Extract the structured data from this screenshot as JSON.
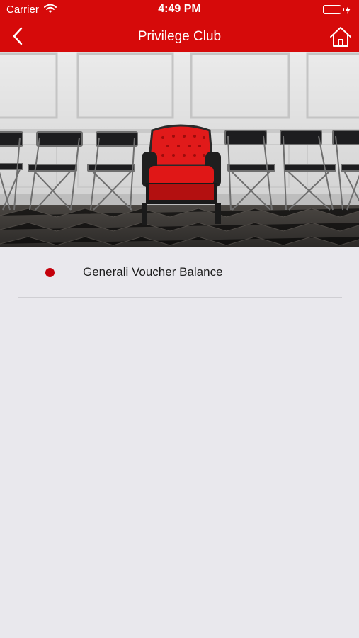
{
  "status_bar": {
    "carrier": "Carrier",
    "time": "4:49 PM",
    "battery_color": "#4cd964"
  },
  "nav": {
    "title": "Privilege Club",
    "back_icon": "chevron-left-icon",
    "home_icon": "home-icon",
    "background_color": "#d60a0a"
  },
  "hero": {
    "image": "Red velvet armchair among a row of black folding chairs against a white paneled wall"
  },
  "list": {
    "items": [
      {
        "label": "Generali Voucher Balance",
        "bullet_color": "#c4000b"
      }
    ]
  }
}
